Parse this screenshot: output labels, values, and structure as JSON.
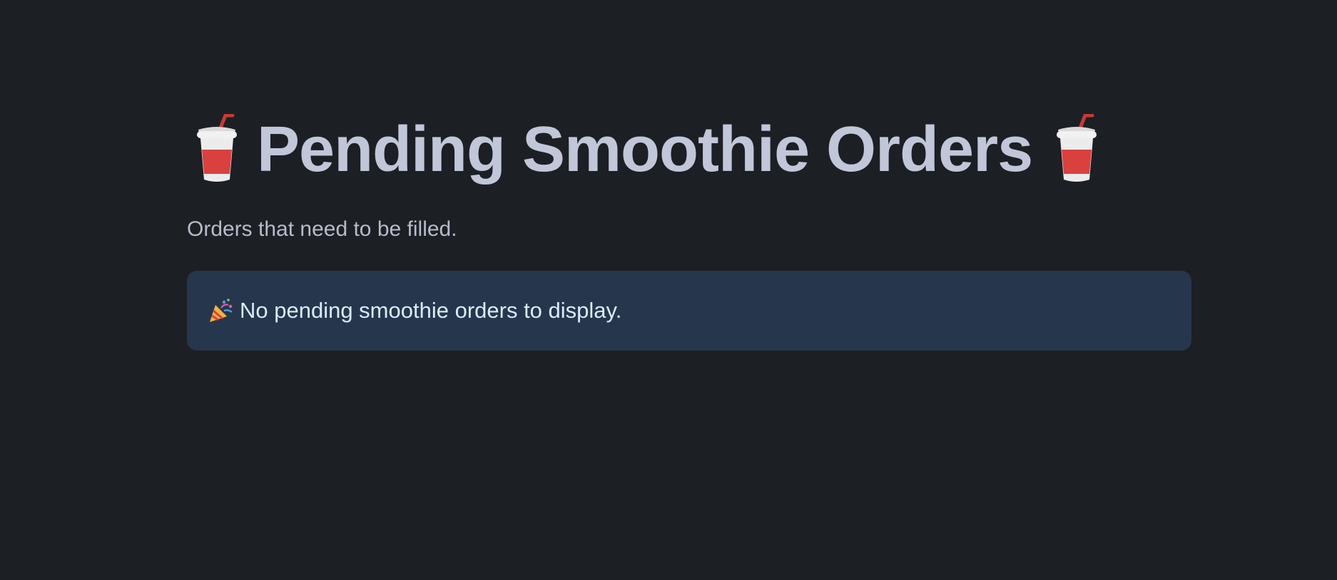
{
  "header": {
    "title": "Pending Smoothie Orders",
    "leading_icon": "cup-with-straw-icon",
    "trailing_icon": "cup-with-straw-icon"
  },
  "subtitle": "Orders that need to be filled.",
  "info_alert": {
    "icon": "party-popper-icon",
    "message": "No pending smoothie orders to display."
  },
  "colors": {
    "background": "#1c1f24",
    "title": "#c1c6d8",
    "alert_background": "#26364d",
    "alert_text": "#d8ecfb",
    "cup_red": "#d9413f"
  }
}
